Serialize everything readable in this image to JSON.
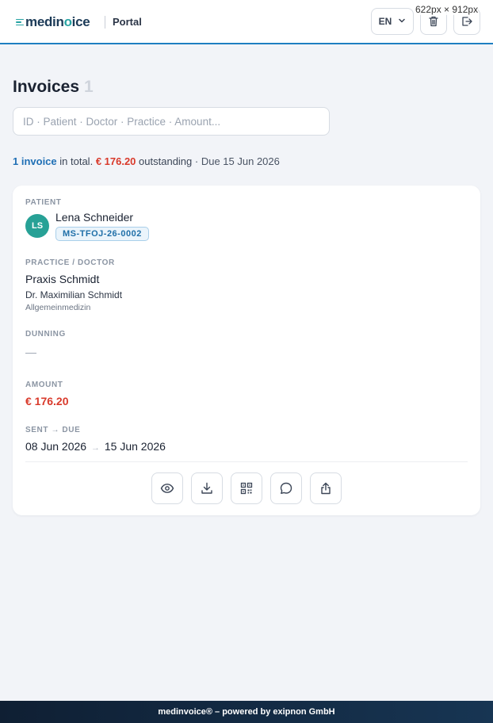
{
  "header": {
    "logo_pre": "medin",
    "logo_o": "o",
    "logo_post": "ice",
    "portal_label": "Portal",
    "language": "EN",
    "dimensions_label": "622px × 912px"
  },
  "main": {
    "title": "Invoices",
    "title_count": "1",
    "search_placeholder": "ID · Patient · Doctor · Practice · Amount...",
    "summary": {
      "count": "1 invoice",
      "in_total": "in total.",
      "outstanding_amount": "€ 176.20",
      "outstanding_label": "outstanding",
      "due": "· Due 15 Jun 2026"
    }
  },
  "card": {
    "patient_label": "PATIENT",
    "avatar_initials": "LS",
    "patient_name": "Lena Schneider",
    "patient_id": "MS-TFOJ-26-0002",
    "practice_label": "PRACTICE / DOCTOR",
    "practice_name": "Praxis Schmidt",
    "doctor_name": "Dr. Maximilian Schmidt",
    "specialty": "Allgemeinmedizin",
    "dunning_label": "DUNNING",
    "dunning_value": "—",
    "amount_label": "AMOUNT",
    "amount_value": "€ 176.20",
    "dates_label": "SENT → DUE",
    "sent_date": "08 Jun 2026",
    "date_arrow": "→",
    "due_date": "15 Jun 2026"
  },
  "footer": {
    "text": "medinvoice® – powered by exipnon GmbH"
  },
  "colors": {
    "accent": "#1f7fc1",
    "teal": "#27a196",
    "danger": "#d93a2b",
    "footer_bg": "#0f1f33"
  },
  "icons": {
    "header": [
      "chevron-down-icon",
      "trash-icon",
      "logout-icon"
    ],
    "actions": [
      "eye-icon",
      "download-icon",
      "qr-code-icon",
      "chat-icon",
      "share-icon"
    ]
  }
}
